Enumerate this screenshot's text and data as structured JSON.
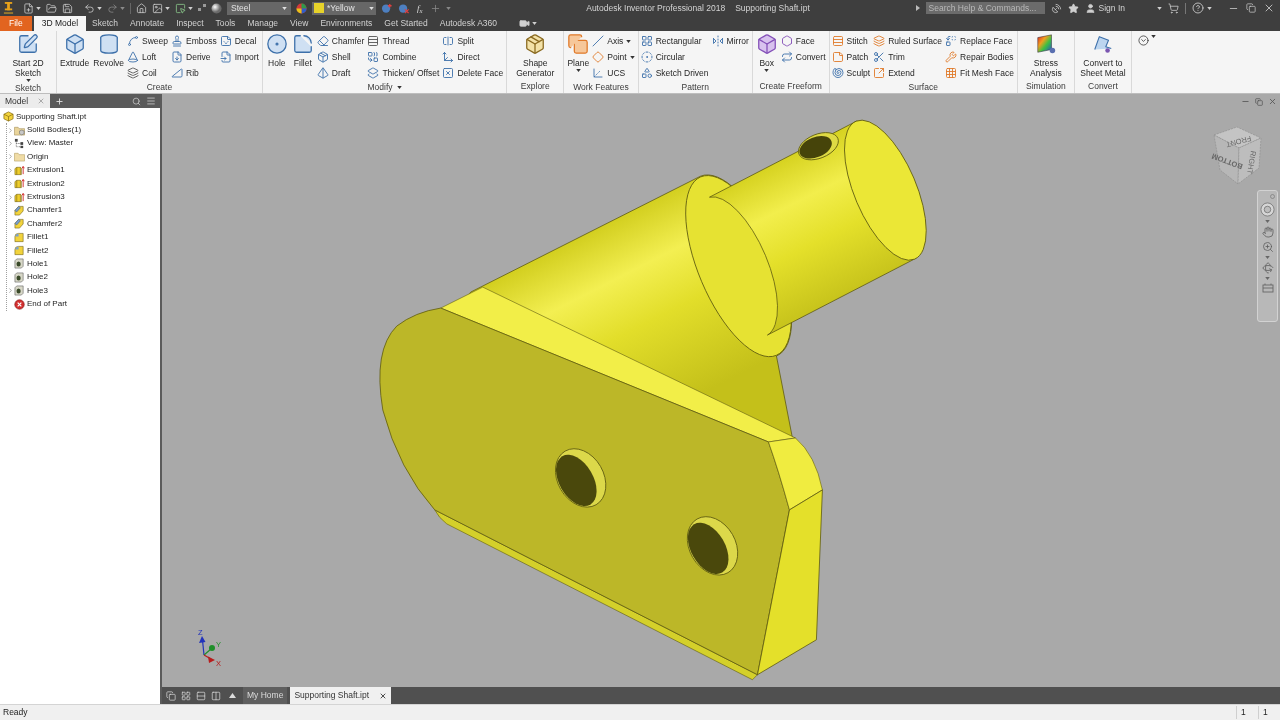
{
  "title_bar": {
    "material": "Steel",
    "appearance": "*Yellow",
    "parameters": "f$_{x}$",
    "title": "Autodesk Inventor Professional 2018",
    "document": "Supporting Shaft.ipt",
    "search": {
      "placeholder": "Search Help & Commands..."
    },
    "sign_in": "Sign In"
  },
  "ribbon_tabs": [
    {
      "label": "File",
      "kind": "application",
      "selected": false
    },
    {
      "label": "3D Model",
      "kind": "tab",
      "selected": true
    },
    {
      "label": "Sketch",
      "kind": "tab",
      "selected": false
    },
    {
      "label": "Annotate",
      "kind": "tab",
      "selected": false
    },
    {
      "label": "Inspect",
      "kind": "tab",
      "selected": false
    },
    {
      "label": "Tools",
      "kind": "tab",
      "selected": false
    },
    {
      "label": "Manage",
      "kind": "tab",
      "selected": false
    },
    {
      "label": "View",
      "kind": "tab",
      "selected": false
    },
    {
      "label": "Environments",
      "kind": "tab",
      "selected": false
    },
    {
      "label": "Get Started",
      "kind": "tab",
      "selected": false
    },
    {
      "label": "Autodesk A360",
      "kind": "tab",
      "selected": false
    }
  ],
  "ribbon_panels": [
    {
      "label": "Sketch",
      "dropdown": false,
      "large": [
        {
          "label": "Start 2D Sketch",
          "dropdown": true
        }
      ]
    },
    {
      "label": "Create",
      "dropdown": false,
      "large": [
        {
          "label": "Extrude",
          "dropdown": false
        },
        {
          "label": "Revolve",
          "dropdown": false
        }
      ],
      "columns": [
        [
          {
            "label": "Sweep",
            "dropdown": false
          },
          {
            "label": "Loft",
            "dropdown": false
          },
          {
            "label": "Coil",
            "dropdown": false
          }
        ],
        [
          {
            "label": "Emboss",
            "dropdown": false
          },
          {
            "label": "Derive",
            "dropdown": false
          },
          {
            "label": "Rib",
            "dropdown": false
          }
        ],
        [
          {
            "label": "Decal",
            "dropdown": false
          },
          {
            "label": "Import",
            "dropdown": false
          }
        ]
      ]
    },
    {
      "label": "Modify",
      "dropdown": true,
      "large": [
        {
          "label": "Hole",
          "dropdown": false
        },
        {
          "label": "Fillet",
          "dropdown": false
        }
      ],
      "columns": [
        [
          {
            "label": "Chamfer",
            "dropdown": false
          },
          {
            "label": "Shell",
            "dropdown": false
          },
          {
            "label": "Draft",
            "dropdown": false
          }
        ],
        [
          {
            "label": "Thread",
            "dropdown": false
          },
          {
            "label": "Combine",
            "dropdown": false
          },
          {
            "label": "Thicken/ Offset",
            "dropdown": false
          }
        ],
        [
          {
            "label": "Split",
            "dropdown": false
          },
          {
            "label": "Direct",
            "dropdown": false
          },
          {
            "label": "Delete Face",
            "dropdown": false
          }
        ]
      ]
    },
    {
      "label": "Explore",
      "dropdown": false,
      "large": [
        {
          "label": "Shape Generator",
          "dropdown": false
        }
      ]
    },
    {
      "label": "Work Features",
      "dropdown": false,
      "large": [
        {
          "label": "Plane",
          "dropdown": true
        }
      ],
      "columns": [
        [
          {
            "label": "Axis",
            "dropdown": true
          },
          {
            "label": "Point",
            "dropdown": true
          },
          {
            "label": "UCS",
            "dropdown": false
          }
        ]
      ]
    },
    {
      "label": "Pattern",
      "dropdown": false,
      "columns": [
        [
          {
            "label": "Rectangular",
            "dropdown": false
          },
          {
            "label": "Circular",
            "dropdown": false
          },
          {
            "label": "Sketch Driven",
            "dropdown": false
          }
        ],
        [
          {
            "label": "Mirror",
            "dropdown": false
          }
        ]
      ]
    },
    {
      "label": "Create Freeform",
      "dropdown": false,
      "large": [
        {
          "label": "Box",
          "dropdown": true
        }
      ],
      "columns": [
        [
          {
            "label": "Face",
            "dropdown": false
          },
          {
            "label": "Convert",
            "dropdown": false
          }
        ]
      ]
    },
    {
      "label": "Surface",
      "dropdown": false,
      "columns": [
        [
          {
            "label": "Stitch",
            "dropdown": false
          },
          {
            "label": "Patch",
            "dropdown": false
          },
          {
            "label": "Sculpt",
            "dropdown": false
          }
        ],
        [
          {
            "label": "Ruled Surface",
            "dropdown": false
          },
          {
            "label": "Trim",
            "dropdown": false
          },
          {
            "label": "Extend",
            "dropdown": false
          }
        ],
        [
          {
            "label": "Replace Face",
            "dropdown": false
          },
          {
            "label": "Repair Bodies",
            "dropdown": false
          },
          {
            "label": "Fit Mesh Face",
            "dropdown": false
          }
        ]
      ]
    },
    {
      "label": "Simulation",
      "dropdown": false,
      "large": [
        {
          "label": "Stress Analysis",
          "dropdown": false
        }
      ]
    },
    {
      "label": "Convert",
      "dropdown": false,
      "large": [
        {
          "label": "Convert to Sheet Metal",
          "dropdown": false
        }
      ]
    }
  ],
  "model_browser": {
    "tabs": [
      {
        "label": "Model",
        "selected": true
      }
    ],
    "tree": [
      {
        "label": "Supporting Shaft.ipt",
        "kind": "part",
        "children": [
          {
            "label": "Solid Bodies(1)",
            "kind": "bodies",
            "expandable": true
          },
          {
            "label": "View: Master",
            "kind": "view",
            "expandable": true
          },
          {
            "label": "Origin",
            "kind": "folder",
            "expandable": true
          },
          {
            "label": "Extrusion1",
            "kind": "extrusion",
            "expandable": true
          },
          {
            "label": "Extrusion2",
            "kind": "extrusion",
            "expandable": true
          },
          {
            "label": "Extrusion3",
            "kind": "extrusion",
            "expandable": true
          },
          {
            "label": "Chamfer1",
            "kind": "chamfer",
            "expandable": false
          },
          {
            "label": "Chamfer2",
            "kind": "chamfer",
            "expandable": false
          },
          {
            "label": "Fillet1",
            "kind": "fillet",
            "expandable": false
          },
          {
            "label": "Fillet2",
            "kind": "fillet",
            "expandable": false
          },
          {
            "label": "Hole1",
            "kind": "hole",
            "expandable": false
          },
          {
            "label": "Hole2",
            "kind": "hole",
            "expandable": false
          },
          {
            "label": "Hole3",
            "kind": "hole",
            "expandable": true
          },
          {
            "label": "End of Part",
            "kind": "end",
            "expandable": false
          }
        ]
      }
    ]
  },
  "viewport": {
    "view_cube": {
      "faces": [
        "FRONT",
        "BOTTOM",
        "RIGHT"
      ]
    },
    "triad": {
      "axes": [
        {
          "label": "Z",
          "color": "#2233bb"
        },
        {
          "label": "Y",
          "color": "#1f8f2a"
        },
        {
          "label": "X",
          "color": "#b81c1c"
        }
      ]
    }
  },
  "document_tabs": [
    {
      "label": "My Home",
      "selected": false,
      "closable": false
    },
    {
      "label": "Supporting Shaft.ipt",
      "selected": true,
      "closable": true
    }
  ],
  "status_bar": {
    "message": "Ready",
    "fields": [
      "1",
      "1"
    ]
  }
}
